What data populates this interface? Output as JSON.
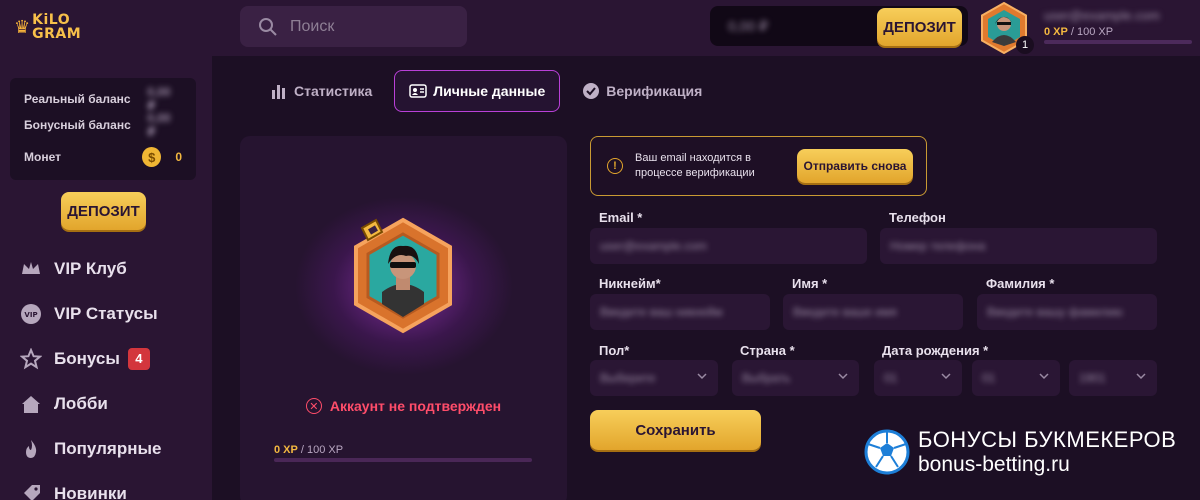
{
  "header": {
    "logo_line1": "KiLO",
    "logo_line2": "GRAM",
    "search_placeholder": "Поиск",
    "balance_value": "0,00 ₽",
    "deposit_label": "ДЕПОЗИТ",
    "avatar_level": "1",
    "user_email": "user@example.com",
    "xp_current": "0 XP",
    "xp_max": " / 100 XP"
  },
  "sidebar": {
    "balances": [
      {
        "label": "Реальный баланс",
        "value": "0,00 ₽"
      },
      {
        "label": "Бонусный баланс",
        "value": "0,00 ₽"
      }
    ],
    "coins_label": "Монет",
    "coins_value": "0",
    "deposit_label": "ДЕПОЗИТ",
    "menu": [
      {
        "label": "VIP Клуб",
        "icon": "crown-icon"
      },
      {
        "label": "VIP Статусы",
        "icon": "vip-icon"
      },
      {
        "label": "Бонусы",
        "icon": "star-icon",
        "badge": "4"
      },
      {
        "label": "Лобби",
        "icon": "home-icon"
      },
      {
        "label": "Популярные",
        "icon": "flame-icon"
      },
      {
        "label": "Новинки",
        "icon": "new-icon"
      }
    ]
  },
  "tabs": [
    {
      "label": "Статистика",
      "icon": "stats-icon"
    },
    {
      "label": "Личные данные",
      "icon": "profile-card-icon",
      "active": true
    },
    {
      "label": "Верификация",
      "icon": "check-circle-icon"
    }
  ],
  "profile": {
    "status": "Аккаунт не подтвержден",
    "xp_current": "0 XP",
    "xp_max": " / 100 XP",
    "progress": 0
  },
  "notice": {
    "text": "Ваш email находится в процессе верификации",
    "button": "Отправить снова"
  },
  "form": {
    "email_label": "Email *",
    "email_value": "user@example.com",
    "phone_label": "Телефон",
    "phone_placeholder": "Номер телефона",
    "nickname_label": "Никнейм*",
    "nickname_placeholder": "Введите ваш никнейм",
    "name_label": "Имя *",
    "name_placeholder": "Введите ваше имя",
    "surname_label": "Фамилия *",
    "surname_placeholder": "Введите вашу фамилию",
    "gender_label": "Пол*",
    "gender_value": "Выберите",
    "country_label": "Страна *",
    "country_value": "Выбрать",
    "birth_label": "Дата рождения *",
    "birth_day": "01",
    "birth_month": "01",
    "birth_year": "1901",
    "save_label": "Сохранить"
  },
  "watermark": {
    "line1": "БОНУСЫ БУКМЕКЕРОВ",
    "line2": "bonus-betting.ru"
  },
  "colors": {
    "accent_gold": "#f3b840",
    "active_tab_border": "#b940d8",
    "error": "#ff4d6a",
    "background": "#1c0f24"
  }
}
